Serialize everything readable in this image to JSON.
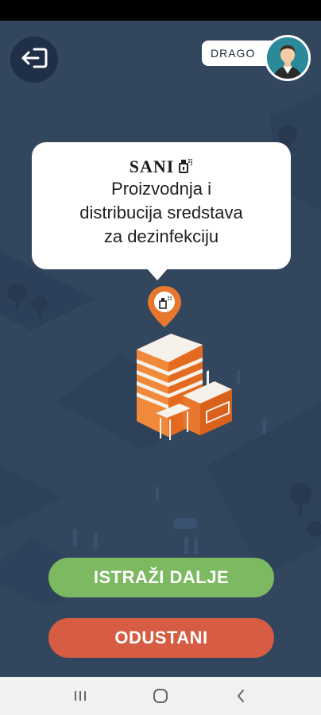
{
  "user": {
    "name": "DRAGO"
  },
  "location": {
    "brand": "SANI",
    "description_lines": [
      "Proizvodnja i",
      "distribucija sredstava",
      "za dezinfekciju"
    ]
  },
  "actions": {
    "explore_label": "ISTRAŽI DALJE",
    "cancel_label": "ODUSTANI"
  },
  "colors": {
    "background": "#32465e",
    "explore_button": "#7cb961",
    "cancel_button": "#d65d43",
    "pin": "#e8772e"
  },
  "icons": {
    "exit": "exit-icon",
    "avatar": "user-avatar",
    "pin": "location-pin-icon",
    "nav_recent": "recent-apps-icon",
    "nav_home": "home-icon",
    "nav_back": "back-icon"
  }
}
